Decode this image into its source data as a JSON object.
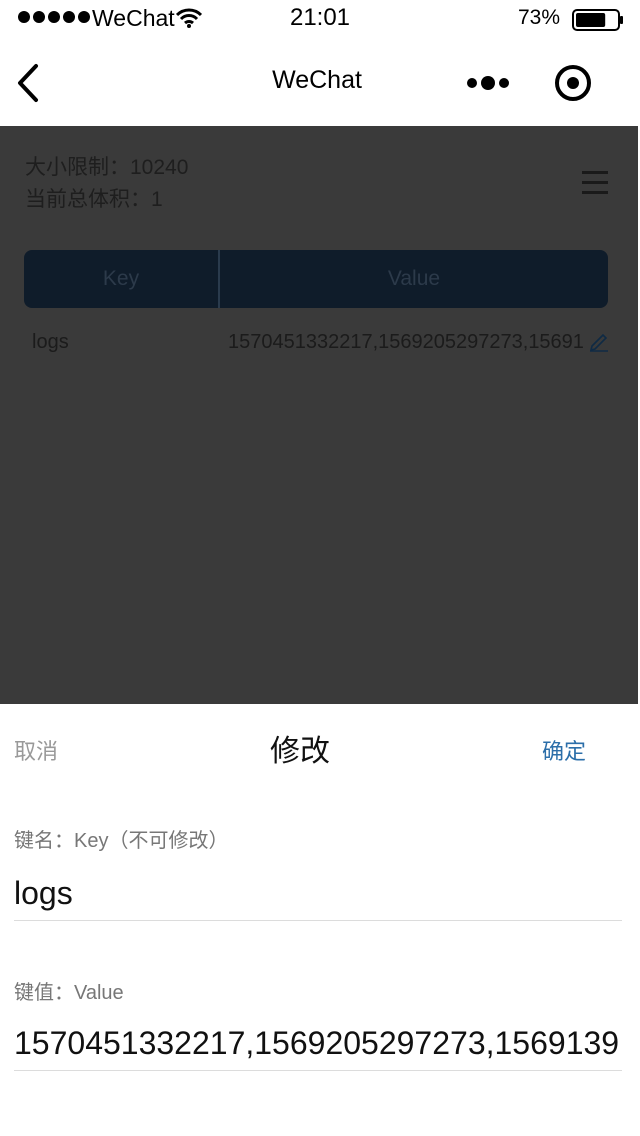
{
  "status_bar": {
    "carrier": "WeChat",
    "time": "21:01",
    "battery_percent": "73%",
    "battery_level": 0.73,
    "icons": [
      "signal-icon",
      "wifi-icon",
      "battery-icon"
    ]
  },
  "nav": {
    "title": "WeChat",
    "icons": [
      "back-icon",
      "more-icon",
      "record-icon"
    ]
  },
  "storage": {
    "size_limit": "大小限制：10240",
    "total_size": "当前总体积：1",
    "table_headers": {
      "key": "Key",
      "value": "Value"
    },
    "rows": [
      {
        "key": "logs",
        "value": "1570451332217,1569205297273,15691"
      }
    ],
    "icons": [
      "menu-icon",
      "edit-icon"
    ]
  },
  "dialog": {
    "cancel": "取消",
    "title": "修改",
    "confirm": "确定",
    "key_label": "键名：Key（不可修改）",
    "key_value": "logs",
    "value_label": "键值：Value",
    "value_value": "1570451332217,1569205297273,1569139"
  },
  "colors": {
    "overlay_bg": "#3a3a3a",
    "table_header_bg": "#0f1c2a",
    "confirm_color": "#2b6ea9",
    "cancel_color": "#999999"
  }
}
